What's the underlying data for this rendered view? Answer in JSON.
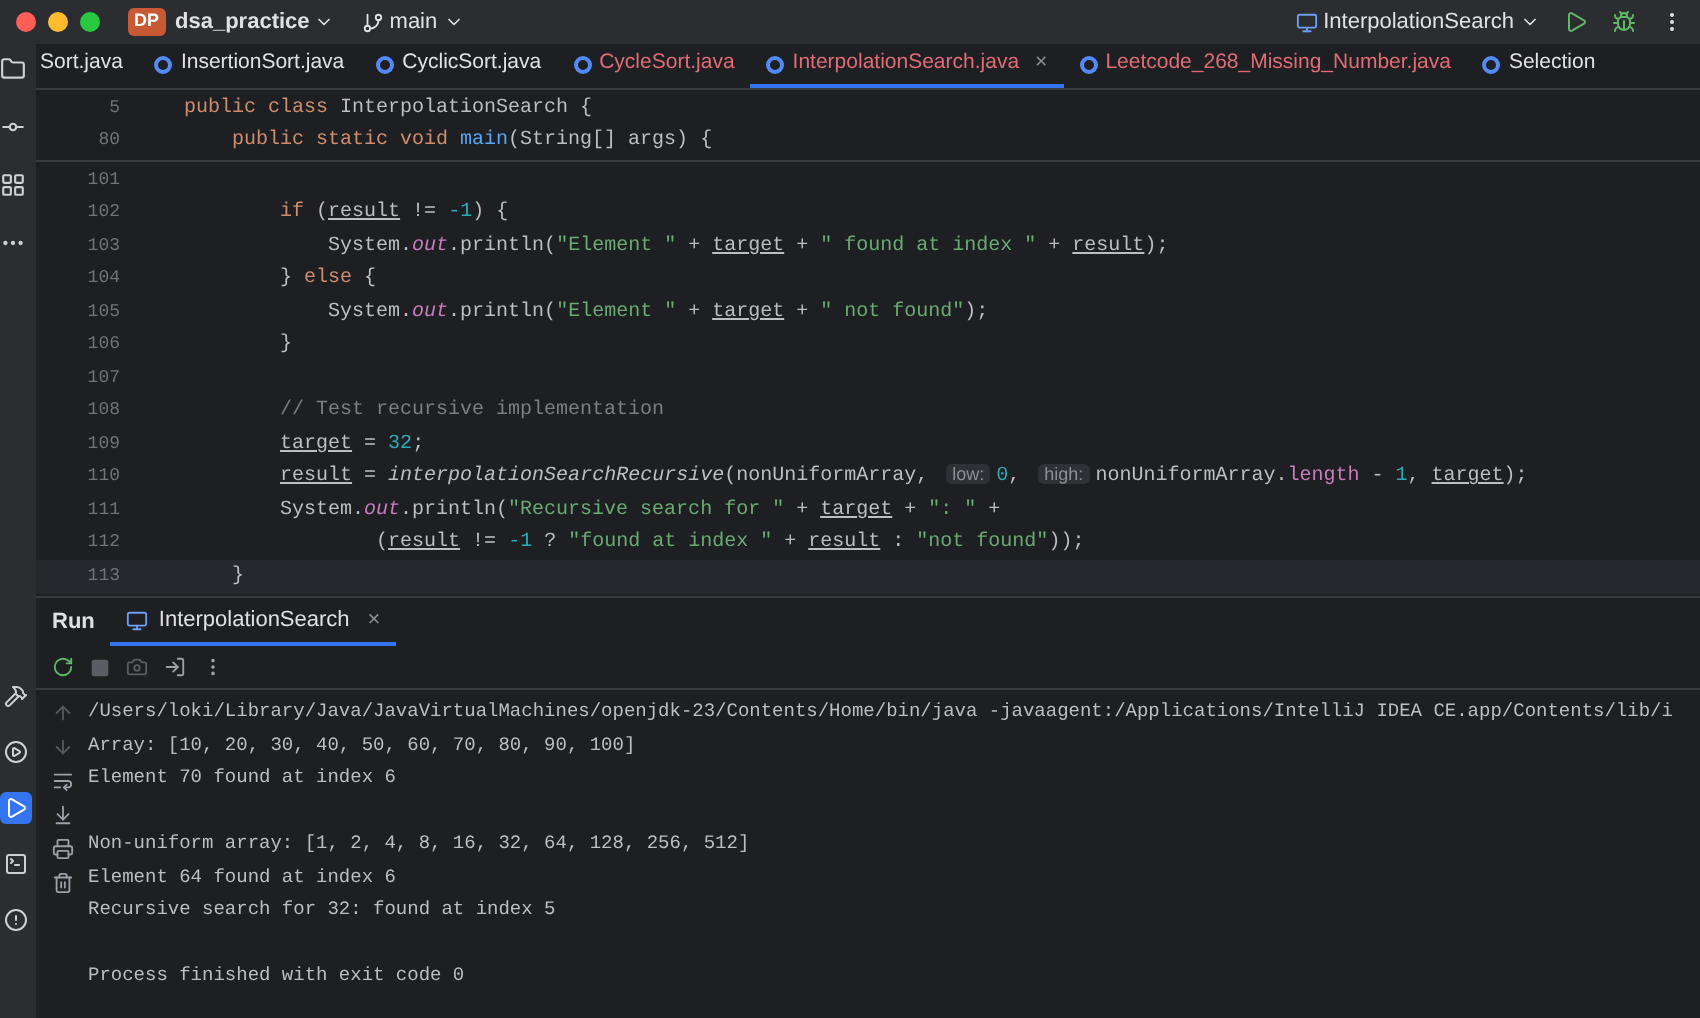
{
  "toolbar": {
    "project_badge": "DP",
    "project": "dsa_practice",
    "branch": "main",
    "run_config": "InterpolationSearch"
  },
  "tabs": [
    {
      "label": "Sort.java",
      "selected": false,
      "color": "#dfe1e5"
    },
    {
      "label": "InsertionSort.java",
      "selected": false,
      "color": "#dfe1e5"
    },
    {
      "label": "CyclicSort.java",
      "selected": false,
      "color": "#dfe1e5"
    },
    {
      "label": "CycleSort.java",
      "selected": false,
      "color": "#e06c75"
    },
    {
      "label": "InterpolationSearch.java",
      "selected": true,
      "color": "#e06c75",
      "close": "×"
    },
    {
      "label": "Leetcode_268_Missing_Number.java",
      "selected": false,
      "color": "#e06c75"
    },
    {
      "label": "Selection",
      "selected": false,
      "color": "#dfe1e5"
    }
  ],
  "sticky_lines": [
    {
      "n": "5",
      "tokens": [
        {
          "kind": "kw",
          "t": "public class "
        },
        {
          "kind": "plain",
          "t": "InterpolationSearch {"
        }
      ]
    },
    {
      "n": "80",
      "tokens": [
        {
          "kind": "kw",
          "t": "    public static void "
        },
        {
          "kind": "decl",
          "t": "main"
        },
        {
          "kind": "plain",
          "t": "(String[] args) {"
        }
      ]
    }
  ],
  "code_lines": [
    {
      "n": "101",
      "current": false
    },
    {
      "n": "102",
      "current": false,
      "tokens": [
        {
          "kind": "kw",
          "t": "        if "
        },
        {
          "kind": "plain",
          "t": "("
        },
        {
          "kind": "var",
          "t": "result"
        },
        {
          "kind": "plain",
          "t": " != "
        },
        {
          "kind": "num",
          "t": "-1"
        },
        {
          "kind": "plain",
          "t": ") {"
        }
      ]
    },
    {
      "n": "103",
      "current": false,
      "tokens": [
        {
          "kind": "plain",
          "t": "            System."
        },
        {
          "kind": "field",
          "t": "out"
        },
        {
          "kind": "plain",
          "t": ".println("
        },
        {
          "kind": "str",
          "t": "\"Element \""
        },
        {
          "kind": "plain",
          "t": " + "
        },
        {
          "kind": "var",
          "t": "target"
        },
        {
          "kind": "plain",
          "t": " + "
        },
        {
          "kind": "str",
          "t": "\" found at index \""
        },
        {
          "kind": "plain",
          "t": " + "
        },
        {
          "kind": "var",
          "t": "result"
        },
        {
          "kind": "plain",
          "t": ");"
        }
      ]
    },
    {
      "n": "104",
      "current": false,
      "tokens": [
        {
          "kind": "plain",
          "t": "        } "
        },
        {
          "kind": "kw",
          "t": "else "
        },
        {
          "kind": "plain",
          "t": "{"
        }
      ]
    },
    {
      "n": "105",
      "current": false,
      "tokens": [
        {
          "kind": "plain",
          "t": "            System."
        },
        {
          "kind": "field",
          "t": "out"
        },
        {
          "kind": "plain",
          "t": ".println("
        },
        {
          "kind": "str",
          "t": "\"Element \""
        },
        {
          "kind": "plain",
          "t": " + "
        },
        {
          "kind": "var",
          "t": "target"
        },
        {
          "kind": "plain",
          "t": " + "
        },
        {
          "kind": "str",
          "t": "\" not found\""
        },
        {
          "kind": "plain",
          "t": ");"
        }
      ]
    },
    {
      "n": "106",
      "current": false,
      "tokens": [
        {
          "kind": "plain",
          "t": "        }"
        }
      ]
    },
    {
      "n": "107",
      "current": false
    },
    {
      "n": "108",
      "current": false,
      "tokens": [
        {
          "kind": "comment",
          "t": "        // Test recursive implementation"
        }
      ]
    },
    {
      "n": "109",
      "current": false,
      "tokens": [
        {
          "kind": "var",
          "t": "        target"
        },
        {
          "kind": "plain",
          "t": " = "
        },
        {
          "kind": "num",
          "t": "32"
        },
        {
          "kind": "plain",
          "t": ";"
        }
      ]
    },
    {
      "n": "110",
      "current": false,
      "tokens": [
        {
          "kind": "var",
          "t": "        result"
        },
        {
          "kind": "plain",
          "t": " = "
        },
        {
          "kind": "call",
          "t": "interpolationSearchRecursive"
        },
        {
          "kind": "plain",
          "t": "(nonUniformArray, "
        },
        {
          "kind": "hint",
          "t": "low:"
        },
        {
          "kind": "num",
          "t": "0"
        },
        {
          "kind": "plain",
          "t": ", "
        },
        {
          "kind": "hint",
          "t": "high:"
        },
        {
          "kind": "plain",
          "t": "nonUniformArray."
        },
        {
          "kind": "member",
          "t": "length"
        },
        {
          "kind": "plain",
          "t": " - "
        },
        {
          "kind": "num",
          "t": "1"
        },
        {
          "kind": "plain",
          "t": ", "
        },
        {
          "kind": "var",
          "t": "target"
        },
        {
          "kind": "plain",
          "t": ");"
        }
      ]
    },
    {
      "n": "111",
      "current": false,
      "tokens": [
        {
          "kind": "plain",
          "t": "        System."
        },
        {
          "kind": "field",
          "t": "out"
        },
        {
          "kind": "plain",
          "t": ".println("
        },
        {
          "kind": "str",
          "t": "\"Recursive search for \""
        },
        {
          "kind": "plain",
          "t": " + "
        },
        {
          "kind": "var",
          "t": "target"
        },
        {
          "kind": "plain",
          "t": " + "
        },
        {
          "kind": "str",
          "t": "\": \""
        },
        {
          "kind": "plain",
          "t": " +"
        }
      ]
    },
    {
      "n": "112",
      "current": false,
      "tokens": [
        {
          "kind": "plain",
          "t": "                ("
        },
        {
          "kind": "var",
          "t": "result"
        },
        {
          "kind": "plain",
          "t": " != "
        },
        {
          "kind": "num",
          "t": "-1"
        },
        {
          "kind": "plain",
          "t": " ? "
        },
        {
          "kind": "str",
          "t": "\"found at index \""
        },
        {
          "kind": "plain",
          "t": " + "
        },
        {
          "kind": "var",
          "t": "result"
        },
        {
          "kind": "plain",
          "t": " : "
        },
        {
          "kind": "str",
          "t": "\"not found\""
        },
        {
          "kind": "plain",
          "t": "));"
        }
      ]
    },
    {
      "n": "113",
      "current": true,
      "tokens": [
        {
          "kind": "plain",
          "t": "    }"
        }
      ]
    }
  ],
  "run_panel": {
    "title": "Run",
    "tab": "InterpolationSearch",
    "tab_close": "×",
    "console_blocks": [
      [
        "/Users/loki/Library/Java/JavaVirtualMachines/openjdk-23/Contents/Home/bin/java -javaagent:/Applications/IntelliJ IDEA CE.app/Contents/lib/i",
        "Array: [10, 20, 30, 40, 50, 60, 70, 80, 90, 100]",
        "Element 70 found at index 6"
      ],
      [
        "Non-uniform array: [1, 2, 4, 8, 16, 32, 64, 128, 256, 512]",
        "Element 64 found at index 6",
        "Recursive search for 32: found at index 5"
      ],
      [
        "Process finished with exit code 0"
      ]
    ]
  },
  "side_tools": [
    {
      "kind": "build",
      "selected": false
    },
    {
      "kind": "services",
      "selected": false
    },
    {
      "kind": "run",
      "selected": true
    },
    {
      "kind": "terminal",
      "selected": false
    },
    {
      "kind": "problems",
      "selected": false
    }
  ]
}
